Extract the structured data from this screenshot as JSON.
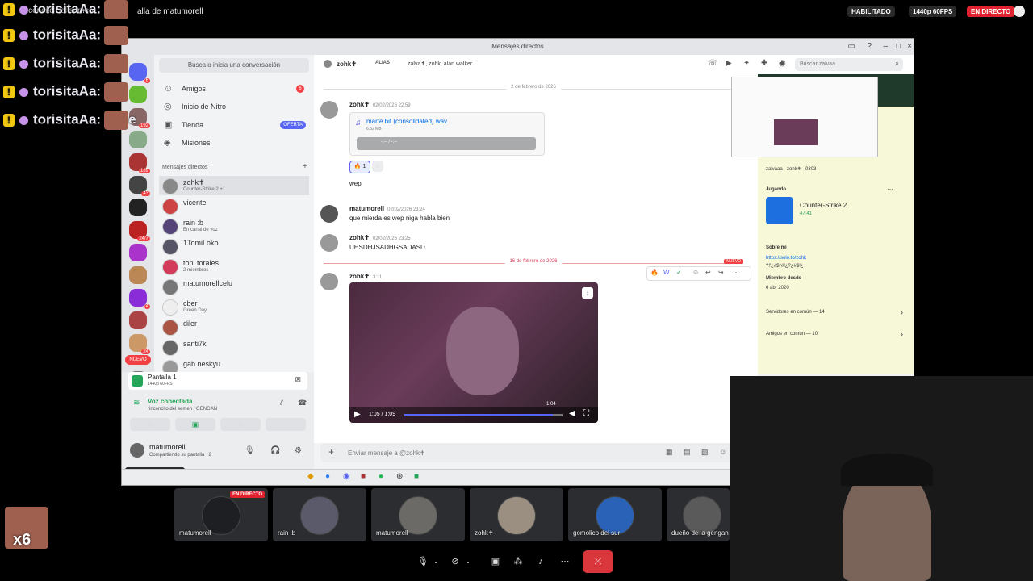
{
  "overlay": {
    "channel_name": "rinconcito del semen",
    "stream_title": "alla de matumorell",
    "habilitado": "HABILITADO",
    "quality": "1440p 60FPS",
    "live": "EN DIRECTO",
    "chat_lines": [
      {
        "user": "torisitaAa:",
        "suffix": ""
      },
      {
        "user": "torisitaAa:",
        "suffix": ""
      },
      {
        "user": "torisitaAa:",
        "suffix": ""
      },
      {
        "user": "torisitaAa:",
        "suffix": ""
      },
      {
        "user": "torisitaAa:",
        "suffix": "e"
      }
    ],
    "multiplier": "x6"
  },
  "window": {
    "title": "Mensajes directos",
    "search_placeholder": "Busca o inicia una conversación"
  },
  "servers": {
    "badges": [
      "6",
      "192",
      "189",
      "43",
      "24/7",
      "4",
      "24"
    ],
    "new_label": "NUEVO"
  },
  "nav": {
    "friends": "Amigos",
    "friends_badge": "6",
    "nitro": "Inicio de Nitro",
    "shop": "Tienda",
    "shop_badge": "OFERTA",
    "missions": "Misiones",
    "dm_header": "Mensajes directos",
    "dm_add": "+"
  },
  "dms": [
    {
      "name": "zohk✝",
      "status": "Counter-Strike 2 +1",
      "color": "#888"
    },
    {
      "name": "vicente",
      "status": "",
      "color": "#c44"
    },
    {
      "name": "rain :b",
      "status": "En canal de voz",
      "color": "#554477"
    },
    {
      "name": "1TomiLoko",
      "status": "",
      "color": "#556"
    },
    {
      "name": "toni torales",
      "status": "2 miembros",
      "color": "#d23c5a"
    },
    {
      "name": "matumorellcelu",
      "status": "",
      "color": "#777"
    },
    {
      "name": "cber",
      "status": "Green Day",
      "color": "#eee"
    },
    {
      "name": "diler",
      "status": "",
      "color": "#a54"
    },
    {
      "name": "santi7k",
      "status": "",
      "color": "#666"
    },
    {
      "name": "gab.neskyu",
      "status": "",
      "color": "#999"
    }
  ],
  "voice": {
    "screen_title": "Pantalla 1",
    "screen_sub": "1440p 60FPS",
    "connected": "Voz conectada",
    "channel": "rinconcito del semen / GENGAN",
    "user": "matumorell",
    "user_status": "Compartiendo su pantalla +2",
    "hover_label": "matumorell"
  },
  "chat_header": {
    "name": "zohk✝",
    "alias_label": "ALIAS",
    "aliases": "zalva✝, zohk, alan walker",
    "search": "Buscar zalvaa"
  },
  "messages": {
    "date1": "2 de febrero de 2026",
    "m1_author": "zohk✝",
    "m1_time": "02/02/2026 22:59",
    "attachment_name": "marte bit (consolidated).wav",
    "attachment_size": "6.82 MB",
    "audio_time": "-:-- / -:--",
    "reaction_count": "1",
    "m1_text": "wep",
    "m2_author": "matumorell",
    "m2_time": "02/02/2026 23:24",
    "m2_text": "que mierda es wep niga habla bien",
    "m3_author": "zohk✝",
    "m3_time": "02/02/2026 23:25",
    "m3_text": "UHSDHJSADHGSADASD",
    "date2": "16 de febrero de 2026",
    "new_label": "NUEVO",
    "m4_author": "zohk✝",
    "m4_time": "3:11",
    "video_time": "1:05 / 1:09",
    "video_hover": "1:04",
    "composer": "Enviar mensaje a @zohk✝"
  },
  "profile": {
    "names": "zalvaaa · zohk✝ · 0303",
    "playing_label": "Jugando",
    "game": "Counter-Strike 2",
    "game_time": "47:41",
    "about_label": "Sobre mí",
    "about_link": "https://solo.to/zohk",
    "about_extra": "?!'¿#$°#!¿?¿#$!¿",
    "member_label": "Miembro desde",
    "member_since": "6 abr 2020",
    "servers_common": "Servidores en común — 14",
    "friends_common": "Amigos en común — 10"
  },
  "tiles": [
    {
      "label": "matumorell",
      "live": "EN DIRECTO",
      "color": "#1d1f22"
    },
    {
      "label": "rain :b",
      "live": "",
      "color": "#5a5a6a"
    },
    {
      "label": "matumorell",
      "live": "",
      "color": "#6b6a66"
    },
    {
      "label": "zohk✝",
      "live": "",
      "color": "#9a8f80"
    },
    {
      "label": "gomolico del sur",
      "live": "",
      "color": "#2a62b8"
    },
    {
      "label": "dueño de la gengan",
      "live": "",
      "color": "#5a5a5a"
    }
  ],
  "colors": {
    "accent": "#5865f2",
    "danger": "#da373c",
    "live": "#e0232e",
    "link": "#006ce7"
  }
}
